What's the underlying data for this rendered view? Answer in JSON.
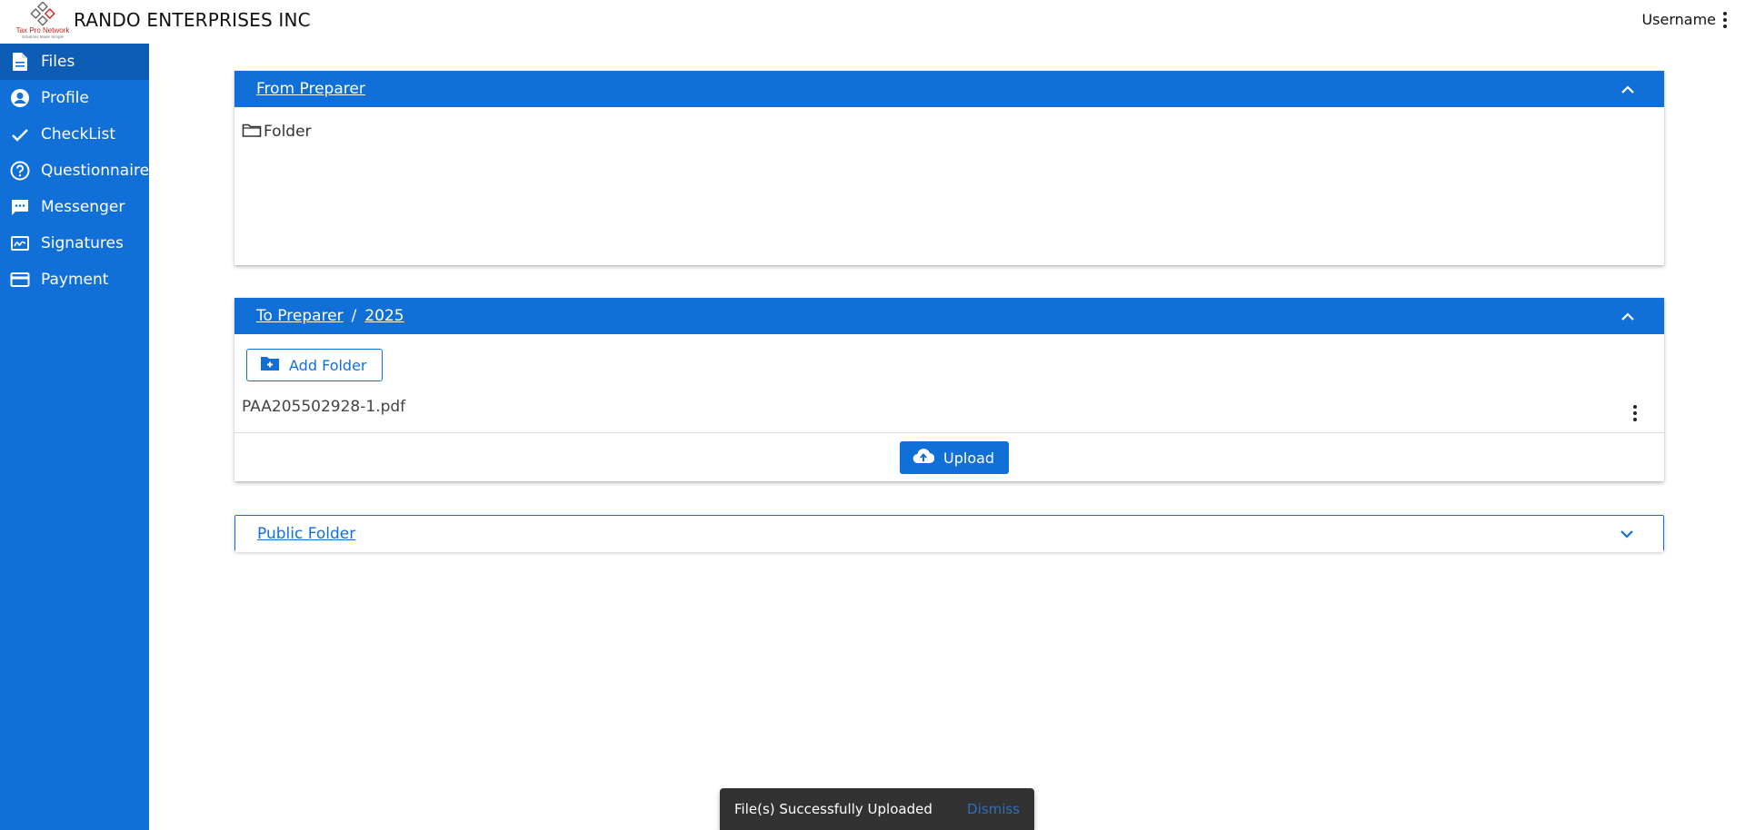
{
  "header": {
    "logo": {
      "brand": "Tax Pro Network",
      "tagline": "Solutions Made Simple",
      "icon": "diamond-logo"
    },
    "company_name": "RANDO ENTERPRISES INC",
    "username": "Username"
  },
  "sidebar": {
    "items": [
      {
        "label": "Files",
        "icon": "file-icon",
        "active": true
      },
      {
        "label": "Profile",
        "icon": "person-circle-icon",
        "active": false
      },
      {
        "label": "CheckList",
        "icon": "check-icon",
        "active": false
      },
      {
        "label": "Questionnaire",
        "icon": "question-circle-icon",
        "active": false
      },
      {
        "label": "Messenger",
        "icon": "chat-icon",
        "active": false
      },
      {
        "label": "Signatures",
        "icon": "signature-icon",
        "active": false
      },
      {
        "label": "Payment",
        "icon": "credit-card-icon",
        "active": false
      }
    ]
  },
  "panels": {
    "from_preparer": {
      "title": "From Preparer",
      "folders": [
        {
          "name": "Folder"
        }
      ]
    },
    "to_preparer": {
      "breadcrumb": [
        "To Preparer",
        "2025"
      ],
      "separator": "/",
      "add_folder_label": "Add Folder",
      "files": [
        {
          "name": "PAA205502928-1.pdf"
        }
      ],
      "upload_label": "Upload"
    },
    "public_folder": {
      "title": "Public Folder"
    }
  },
  "snackbar": {
    "message": "File(s) Successfully Uploaded",
    "action": "Dismiss"
  },
  "colors": {
    "primary": "#1170d8",
    "sidebar_active": "#0d5cb6",
    "snackbar_bg": "#323232"
  }
}
